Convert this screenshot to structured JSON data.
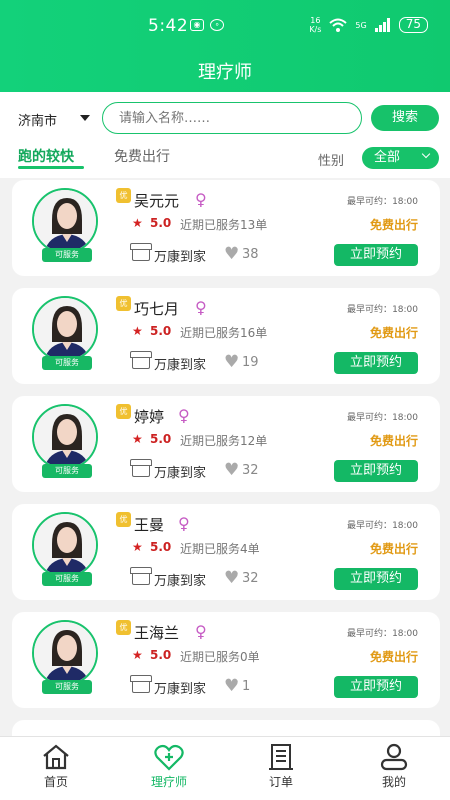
{
  "status_bar": {
    "time": "5:42",
    "speed_top": "16",
    "speed_bottom": "K/s",
    "signal": "5G",
    "battery": "75"
  },
  "header": {
    "title": "理疗师"
  },
  "search": {
    "city": "济南市",
    "placeholder": "请输入名称……",
    "button": "搜索"
  },
  "tabs": {
    "active": "跑的较快",
    "other": "免费出行",
    "gender_label": "性别",
    "gender_value": "全部"
  },
  "therapists": [
    {
      "name": "吴元元",
      "earliest_label": "最早可约：",
      "earliest_time": "18:00",
      "rating": "5.0",
      "served": "近期已服务13单",
      "free": "免费出行",
      "shop": "万康到家",
      "likes": "38",
      "badge": "可服务",
      "you": "优",
      "book": "立即预约"
    },
    {
      "name": "巧七月",
      "earliest_label": "最早可约：",
      "earliest_time": "18:00",
      "rating": "5.0",
      "served": "近期已服务16单",
      "free": "免费出行",
      "shop": "万康到家",
      "likes": "19",
      "badge": "可服务",
      "you": "优",
      "book": "立即预约"
    },
    {
      "name": "婷婷",
      "earliest_label": "最早可约：",
      "earliest_time": "18:00",
      "rating": "5.0",
      "served": "近期已服务12单",
      "free": "免费出行",
      "shop": "万康到家",
      "likes": "32",
      "badge": "可服务",
      "you": "优",
      "book": "立即预约"
    },
    {
      "name": "王曼",
      "earliest_label": "最早可约：",
      "earliest_time": "18:00",
      "rating": "5.0",
      "served": "近期已服务4单",
      "free": "免费出行",
      "shop": "万康到家",
      "likes": "32",
      "badge": "可服务",
      "you": "优",
      "book": "立即预约"
    },
    {
      "name": "王海兰",
      "earliest_label": "最早可约：",
      "earliest_time": "18:00",
      "rating": "5.0",
      "served": "近期已服务0单",
      "free": "免费出行",
      "shop": "万康到家",
      "likes": "1",
      "badge": "可服务",
      "you": "优",
      "book": "立即预约"
    }
  ],
  "nav": [
    {
      "label": "首页",
      "icon": "home-icon"
    },
    {
      "label": "理疗师",
      "icon": "heart-plus-icon"
    },
    {
      "label": "订单",
      "icon": "order-icon"
    },
    {
      "label": "我的",
      "icon": "user-icon"
    }
  ],
  "colors": {
    "primary": "#17c26a",
    "accent_free": "#e19a15",
    "rating": "#cc2222",
    "female": "#c65cc4"
  }
}
